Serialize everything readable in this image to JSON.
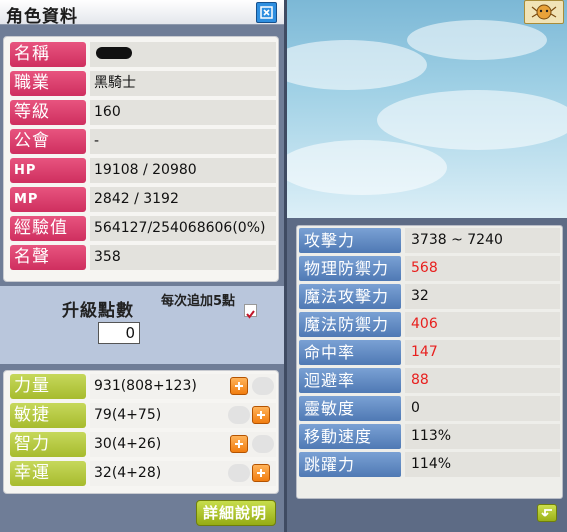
{
  "window": {
    "title": "角色資料"
  },
  "character": {
    "rows": [
      {
        "label": "名稱",
        "value": ""
      },
      {
        "label": "職業",
        "value": "黑騎士"
      },
      {
        "label": "等級",
        "value": "160"
      },
      {
        "label": "公會",
        "value": "-"
      },
      {
        "label": "HP",
        "value": "19108 / 20980"
      },
      {
        "label": "MP",
        "value": "2842 / 3192"
      },
      {
        "label": "經驗值",
        "value": "564127/254068606(0%)"
      },
      {
        "label": "名聲",
        "value": "358"
      }
    ]
  },
  "ap": {
    "label": "升級點數",
    "value": "0",
    "auto_label": "每次追加5點",
    "auto_checked": true
  },
  "stats": [
    {
      "label": "力量",
      "value": "931(808+123)"
    },
    {
      "label": "敏捷",
      "value": "79(4+75)"
    },
    {
      "label": "智力",
      "value": "30(4+26)"
    },
    {
      "label": "幸運",
      "value": "32(4+28)"
    }
  ],
  "detail_button": {
    "label": "詳細說明"
  },
  "details": [
    {
      "label": "攻擊力",
      "value": "3738 ~ 7240",
      "color": "#111111"
    },
    {
      "label": "物理防禦力",
      "value": "568",
      "color": "#e8201e"
    },
    {
      "label": "魔法攻擊力",
      "value": "32",
      "color": "#111111"
    },
    {
      "label": "魔法防禦力",
      "value": "406",
      "color": "#e8201e"
    },
    {
      "label": "命中率",
      "value": "147",
      "color": "#e8201e"
    },
    {
      "label": "迴避率",
      "value": "88",
      "color": "#e8201e"
    },
    {
      "label": "靈敏度",
      "value": "0",
      "color": "#111111"
    },
    {
      "label": "移動速度",
      "value": "113%",
      "color": "#111111"
    },
    {
      "label": "跳躍力",
      "value": "114%",
      "color": "#111111"
    }
  ],
  "icons": {
    "close": "close-icon",
    "corner": "tiger-emblem-icon",
    "plus": "plus-icon",
    "back": "back-arrow-icon",
    "checkmark": "checkmark-icon"
  }
}
